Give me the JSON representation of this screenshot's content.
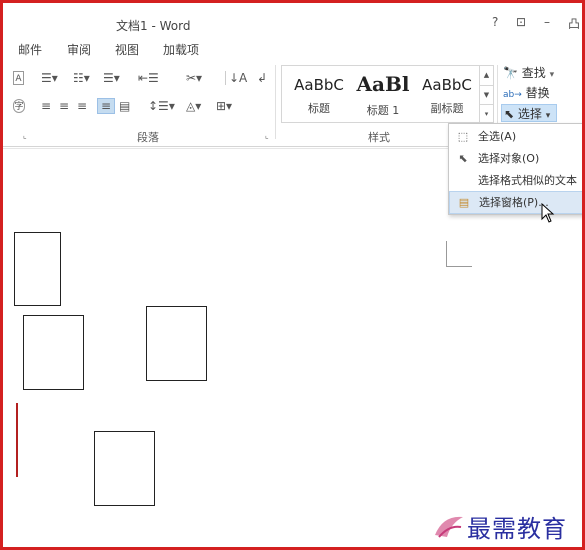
{
  "window": {
    "title": "文档1 - Word",
    "help_label": "?",
    "restore_label": "⊡",
    "minimize_label": "–",
    "extra_label": "凸"
  },
  "ribbon_tabs": [
    {
      "label": "邮件"
    },
    {
      "label": "审阅"
    },
    {
      "label": "视图"
    },
    {
      "label": "加载项"
    }
  ],
  "groups": {
    "paragraph": {
      "label": "段落"
    },
    "styles": {
      "label": "样式"
    }
  },
  "styles_gallery": [
    {
      "sample": "AaBbC",
      "name": "标题"
    },
    {
      "sample": "AaBl",
      "name": "标题 1"
    },
    {
      "sample": "AaBbC",
      "name": "副标题"
    }
  ],
  "editing": {
    "find_label": "查找",
    "find_arrow": "▾",
    "replace_label": "替换",
    "select_label": "选择",
    "select_arrow": "▾"
  },
  "select_menu": {
    "items": [
      {
        "label": "全选(A)",
        "icon": "select-all-icon"
      },
      {
        "label": "选择对象(O)",
        "icon": "pointer-icon"
      },
      {
        "label": "选择格式相似的文本",
        "icon": ""
      },
      {
        "label": "选择窗格(P)...",
        "icon": "selection-pane-icon"
      }
    ]
  },
  "watermark": {
    "text": "最需教育"
  }
}
